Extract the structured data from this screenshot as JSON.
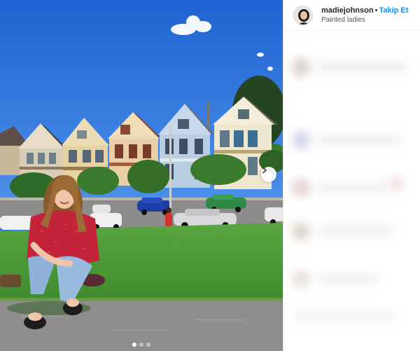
{
  "post": {
    "username": "madiejohnson",
    "separator": "•",
    "follow_label": "Takip Et",
    "location": "Painted ladies"
  },
  "carousel": {
    "slide_count": 3,
    "active_slide": 1,
    "next_icon": "chevron-right-icon"
  },
  "colors": {
    "follow_blue": "#0095f6",
    "sky": "#2f77de",
    "grass": "#4e9a3a"
  }
}
